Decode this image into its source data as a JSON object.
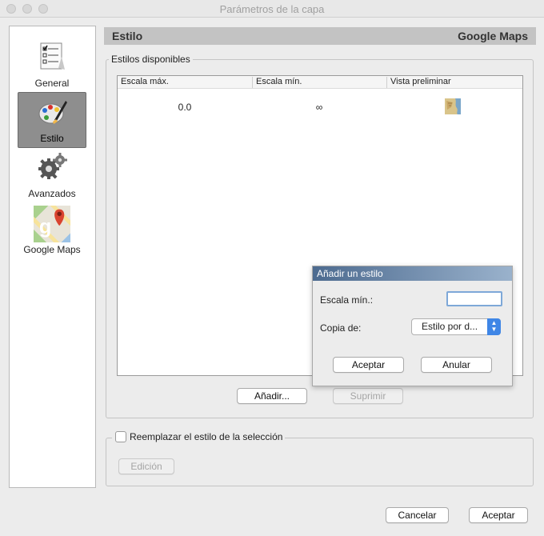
{
  "window": {
    "title": "Parámetros de la capa"
  },
  "sidebar": {
    "items": [
      {
        "label": "General",
        "icon": "checklist-icon",
        "selected": false
      },
      {
        "label": "Estilo",
        "icon": "paint-palette-icon",
        "selected": true
      },
      {
        "label": "Avanzados",
        "icon": "gears-icon",
        "selected": false
      },
      {
        "label": "Google Maps",
        "icon": "google-maps-icon",
        "selected": false
      }
    ]
  },
  "header": {
    "left": "Estilo",
    "right": "Google Maps"
  },
  "styles_group": {
    "title": "Estilos disponibles",
    "columns": [
      "Escala máx.",
      "Escala mín.",
      "Vista preliminar"
    ],
    "rows": [
      {
        "max": "0.0",
        "min": "∞"
      }
    ],
    "add_label": "Añadir...",
    "delete_label": "Suprimir"
  },
  "dialog": {
    "title": "Añadir un estilo",
    "min_scale_label": "Escala mín.:",
    "min_scale_value": "",
    "copy_label": "Copia de:",
    "copy_value": "Estilo por d...",
    "accept_label": "Aceptar",
    "cancel_label": "Anular"
  },
  "replace_group": {
    "checkbox_label": "Reemplazar el estilo de la selección",
    "checked": false,
    "edit_label": "Edición"
  },
  "footer": {
    "cancel_label": "Cancelar",
    "accept_label": "Aceptar"
  },
  "colors": {
    "selection": "#8e8e8e",
    "header_bg": "#c3c3c3",
    "accent": "#3f86e6"
  }
}
